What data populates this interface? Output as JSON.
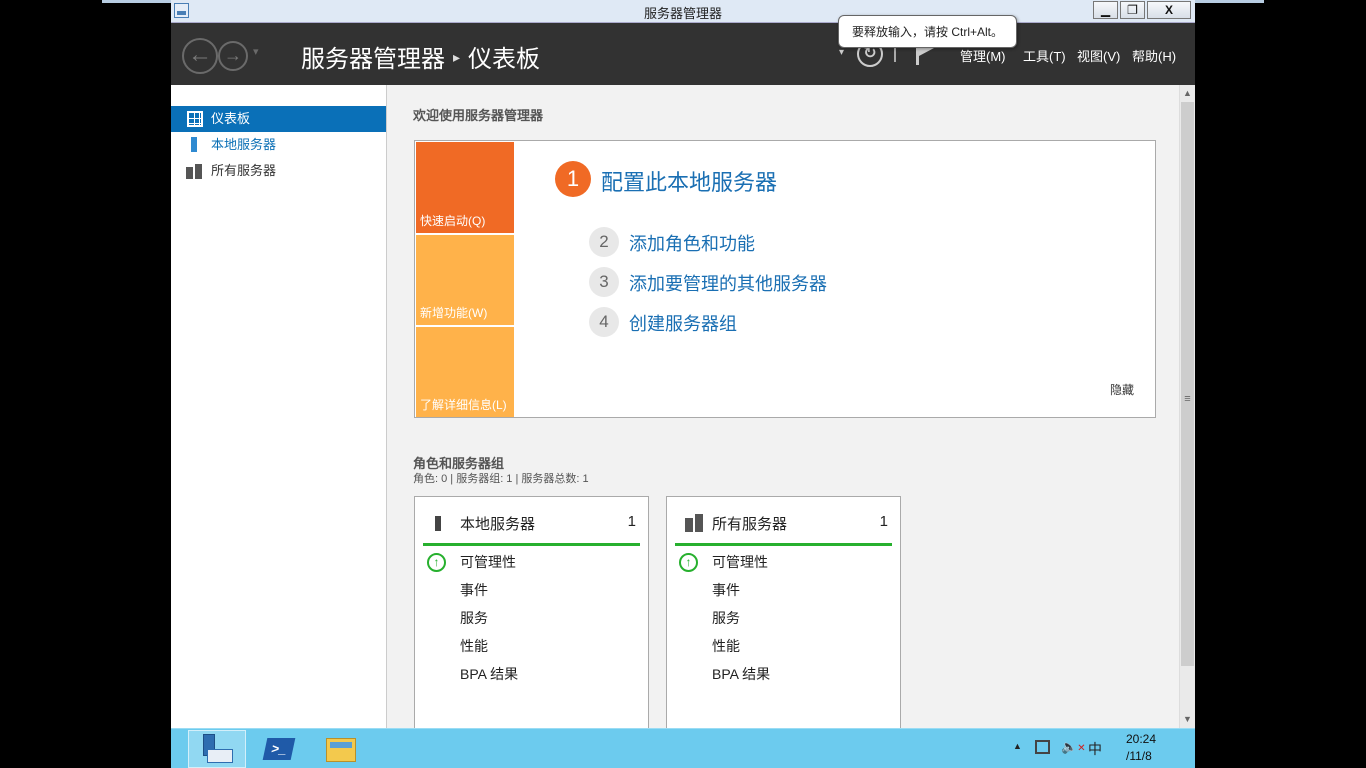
{
  "window": {
    "title": "服务器管理器",
    "controls": {
      "minimize": "▁",
      "restore": "❐",
      "close": "X"
    }
  },
  "tooltip": {
    "text": "要释放输入，请按 Ctrl+Alt。"
  },
  "header": {
    "breadcrumb_root": "服务器管理器",
    "breadcrumb_separator": "▸",
    "breadcrumb_current": "仪表板",
    "nav_back": "←",
    "nav_forward": "→",
    "nav_dropdown": "▾",
    "dropdown": "▾",
    "refresh": "↻",
    "menus": [
      "管理(M)",
      "工具(T)",
      "视图(V)",
      "帮助(H)"
    ]
  },
  "sidebar": {
    "items": [
      {
        "label": "仪表板",
        "icon": "dashboard-grid-icon",
        "selected": true
      },
      {
        "label": "本地服务器",
        "icon": "server-icon"
      },
      {
        "label": "所有服务器",
        "icon": "servers-icon"
      }
    ]
  },
  "main": {
    "welcome_heading": "欢迎使用服务器管理器",
    "quickstart": {
      "tiles": [
        "快速启动(Q)",
        "新增功能(W)",
        "了解详细信息(L)"
      ],
      "steps": [
        {
          "num": "1",
          "label": "配置此本地服务器"
        },
        {
          "num": "2",
          "label": "添加角色和功能"
        },
        {
          "num": "3",
          "label": "添加要管理的其他服务器"
        },
        {
          "num": "4",
          "label": "创建服务器组"
        }
      ],
      "hide_label": "隐藏",
      "accent_color": "#f06a25",
      "tile_color": "#ffb24a"
    },
    "roles_heading": "角色和服务器组",
    "roles_summary": "角色: 0 | 服务器组: 1 | 服务器总数: 1",
    "cards": [
      {
        "title": "本地服务器",
        "count": "1",
        "rows": [
          "可管理性",
          "事件",
          "服务",
          "性能",
          "BPA 结果"
        ],
        "status_color": "#27b02e"
      },
      {
        "title": "所有服务器",
        "count": "1",
        "rows": [
          "可管理性",
          "事件",
          "服务",
          "性能",
          "BPA 结果"
        ],
        "status_color": "#27b02e"
      }
    ]
  },
  "scrollbar": {
    "up": "▲",
    "down": "▼",
    "grip": "≡"
  },
  "taskbar": {
    "apps": [
      "server-manager-icon",
      "powershell-icon",
      "file-explorer-icon"
    ],
    "powershell_glyph": ">_",
    "tray": {
      "show_hidden": "▲",
      "ime": "中",
      "time": "20:24",
      "date": "/11/8",
      "volume_glyph": "🔈",
      "mute_x": "✕"
    }
  }
}
